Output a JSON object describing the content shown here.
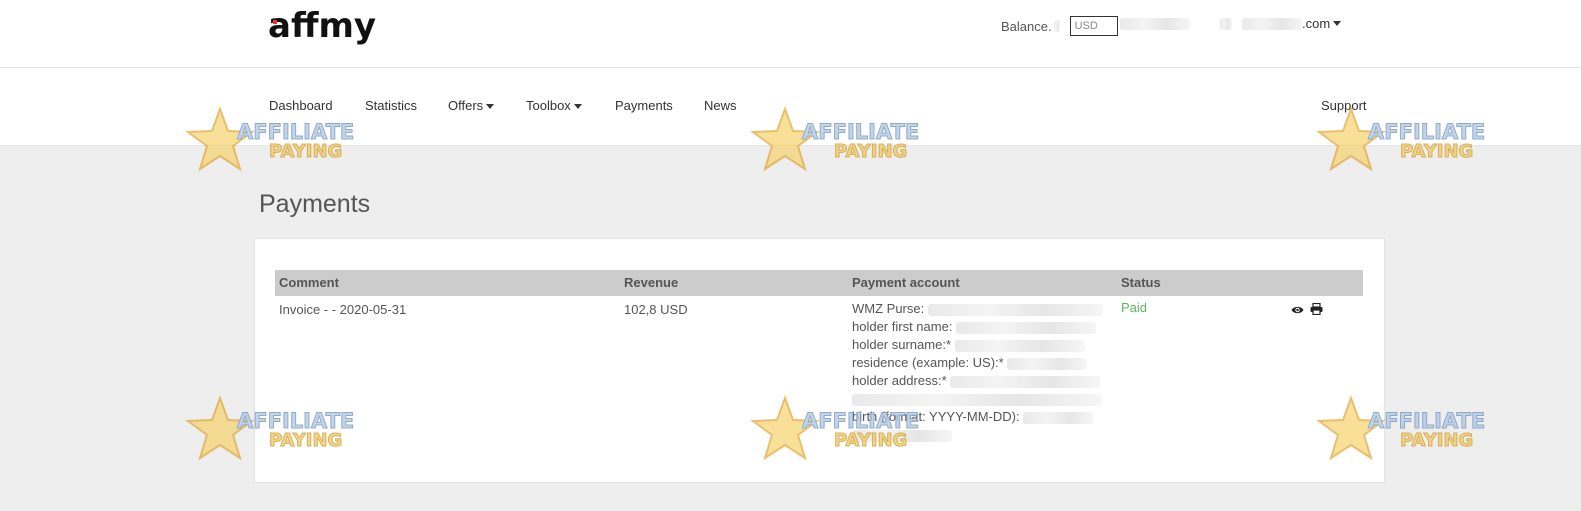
{
  "brand": {
    "logo_text": "affmy"
  },
  "header": {
    "balance_label": "Balance.",
    "currency_select_value": "USD",
    "account_suffix": ".com"
  },
  "nav": {
    "dashboard": "Dashboard",
    "statistics": "Statistics",
    "offers": "Offers",
    "toolbox": "Toolbox",
    "payments": "Payments",
    "news": "News",
    "support": "Support"
  },
  "main": {
    "title": "Payments",
    "table": {
      "columns": [
        "Comment",
        "Revenue",
        "Payment account",
        "Status"
      ],
      "rows": [
        {
          "comment": "Invoice - - 2020-05-31",
          "revenue": "102,8 USD",
          "payment_account_lines": [
            "WMZ Purse:",
            "holder first name:",
            "holder surname:*",
            "residence (example: US):*",
            "holder address:*",
            "",
            "birth (format: YYYY-MM-DD):",
            ""
          ],
          "status": "Paid"
        }
      ]
    }
  },
  "watermark": {
    "line1": "AFFILIATE",
    "line2": "PAYING"
  },
  "colors": {
    "status_paid": "#5cb85c",
    "table_header_bg": "#cccccc",
    "page_bg": "#eeeeee"
  },
  "icons": {
    "view": "eye-icon",
    "print": "printer-icon"
  }
}
